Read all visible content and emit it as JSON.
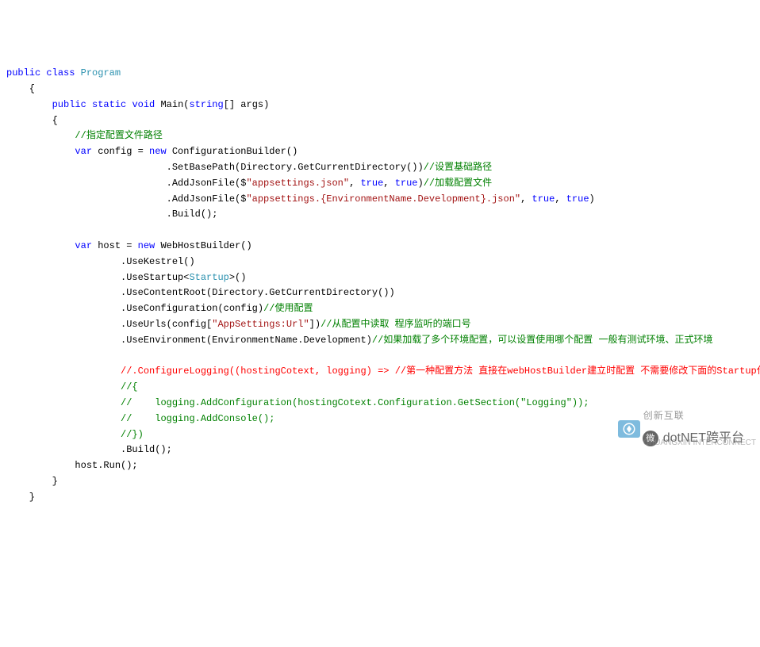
{
  "code": {
    "line1": {
      "kw1": "public",
      "kw2": "class",
      "type": "Program"
    },
    "line2": "    {",
    "line3": {
      "pre": "        ",
      "kw1": "public",
      "kw2": "static",
      "kw3": "void",
      "method": " Main(",
      "kw4": "string",
      "rest": "[] args)"
    },
    "line4": "        {",
    "line5": {
      "pre": "            ",
      "comment": "//指定配置文件路径"
    },
    "line6": {
      "pre": "            ",
      "kw1": "var",
      "mid": " config = ",
      "kw2": "new",
      "rest": " ConfigurationBuilder()"
    },
    "line7": {
      "pre": "                            .SetBasePath(Directory.GetCurrentDirectory())",
      "comment": "//设置基础路径"
    },
    "line8": {
      "pre": "                            .AddJsonFile($",
      "str": "\"appsettings.json\"",
      "mid": ", ",
      "b1": "true",
      "mid2": ", ",
      "b2": "true",
      "end": ")",
      "comment": "//加载配置文件"
    },
    "line9": {
      "pre": "                            .AddJsonFile($",
      "str": "\"appsettings.{EnvironmentName.Development}.json\"",
      "mid": ", ",
      "b1": "true",
      "mid2": ", ",
      "b2": "true",
      "end": ")"
    },
    "line10": "                            .Build();",
    "line11": "",
    "line12": {
      "pre": "            ",
      "kw1": "var",
      "mid": " host = ",
      "kw2": "new",
      "rest": " WebHostBuilder()"
    },
    "line13": "                    .UseKestrel()",
    "line14": {
      "pre": "                    .UseStartup<",
      "type": "Startup",
      "end": ">()"
    },
    "line15": "                    .UseContentRoot(Directory.GetCurrentDirectory())",
    "line16": {
      "pre": "                    .UseConfiguration(config)",
      "comment": "//使用配置"
    },
    "line17": {
      "pre": "                    .UseUrls(config[",
      "str": "\"AppSettings:Url\"",
      "end": "])",
      "comment": "//从配置中读取 程序监听的端口号"
    },
    "line18": {
      "pre": "                    .UseEnvironment(EnvironmentName.Development)",
      "comment": "//如果加载了多个环境配置，可以设置使用哪个配置 一般有测试环境、正式环境"
    },
    "line19": "",
    "line20": {
      "pre": "                    ",
      "comment": "//.ConfigureLogging((hostingCotext, logging) => //第一种配置方法 直接在webHostBuilder建立时配置 不需要修改下面的Startup代码"
    },
    "line21": {
      "pre": "                    ",
      "comment": "//{"
    },
    "line22": {
      "pre": "                    ",
      "comment": "//    logging.AddConfiguration(hostingCotext.Configuration.GetSection(\"Logging\"));"
    },
    "line23": {
      "pre": "                    ",
      "comment": "//    logging.AddConsole();"
    },
    "line24": {
      "pre": "                    ",
      "comment": "//})"
    },
    "line25": "                    .Build();",
    "line26": "            host.Run();",
    "line27": "        }",
    "line28": "    }"
  },
  "watermark": {
    "icon": "微",
    "text": "dotNET跨平台"
  },
  "logo": {
    "line1": "创新互联",
    "line2": "CHUANGXIN INTERCONNECT"
  }
}
